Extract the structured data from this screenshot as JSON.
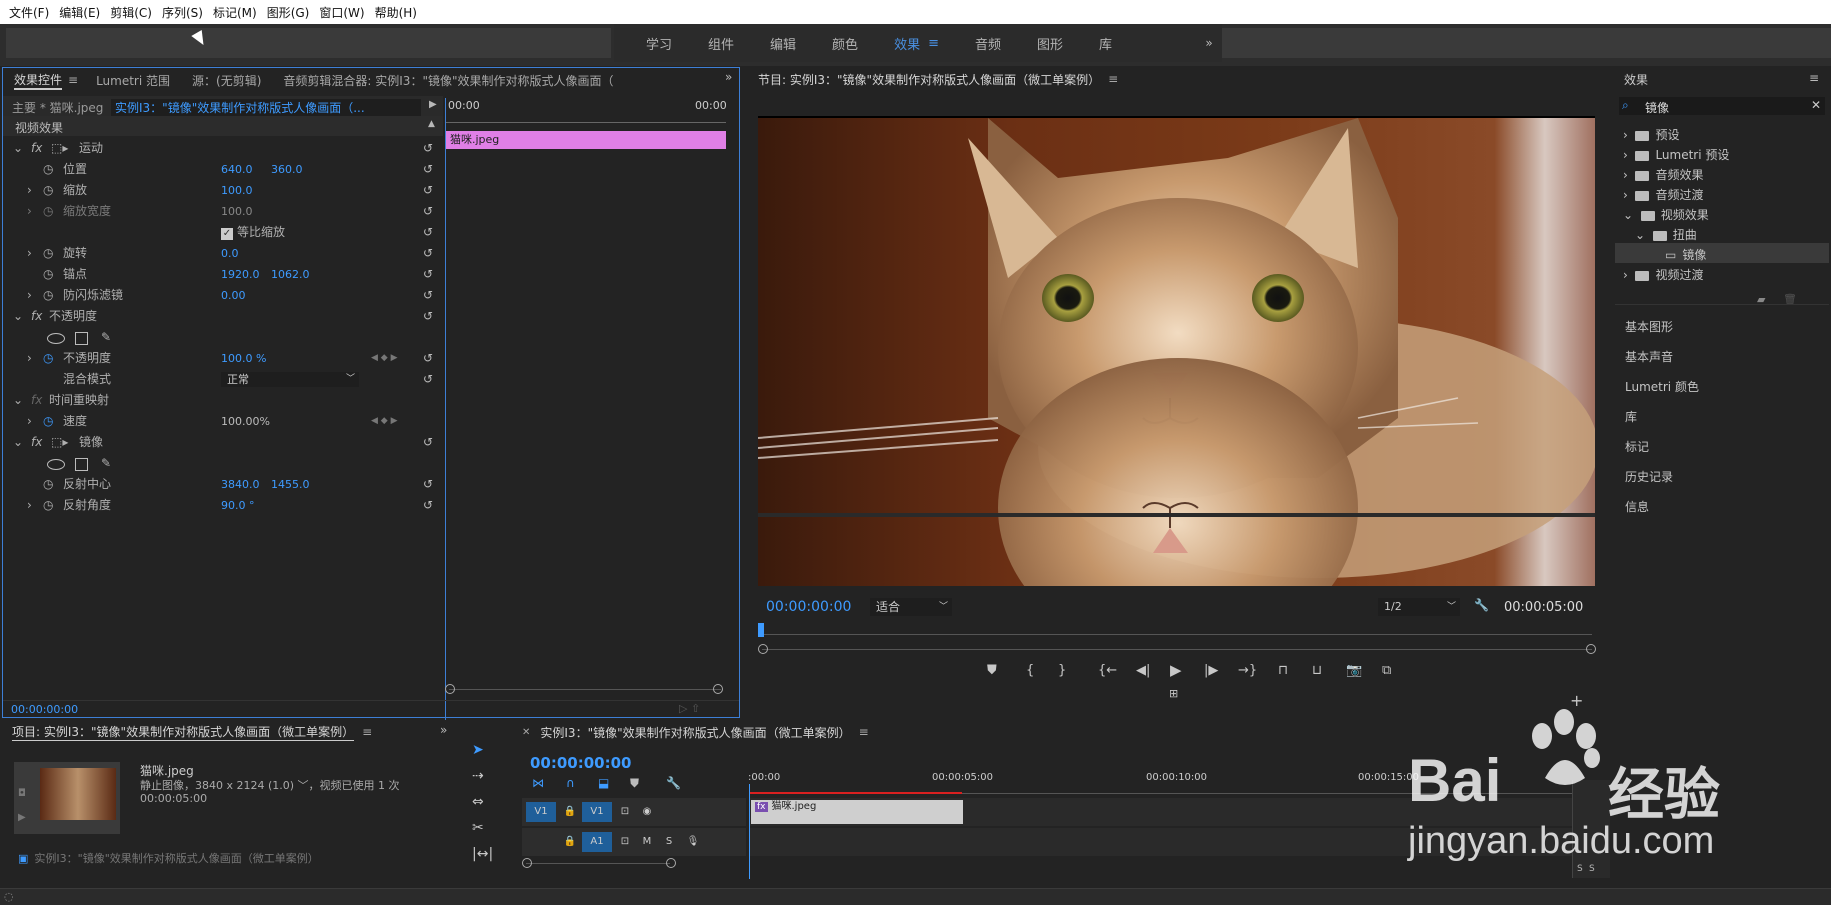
{
  "menu": [
    "文件(F)",
    "编辑(E)",
    "剪辑(C)",
    "序列(S)",
    "标记(M)",
    "图形(G)",
    "窗口(W)",
    "帮助(H)"
  ],
  "workspaces": [
    "学习",
    "组件",
    "编辑",
    "颜色",
    "效果",
    "音频",
    "图形",
    "库"
  ],
  "workspace_active": "效果",
  "ec": {
    "tabs": [
      "效果控件",
      "Lumetri 范围",
      "源：(无剪辑)",
      "音频剪辑混合器: 实例I3：\"镜像\"效果制作对称版式人像画面（"
    ],
    "master": "主要 * 猫咪.jpeg",
    "sequence": "实例I3：\"镜像\"效果制作对称版式人像画面（...",
    "tc_start": "00:00",
    "tc_end": "00:00",
    "clip_name": "猫咪.jpeg",
    "video_effects": "视频效果",
    "motion": "运动",
    "position": "位置",
    "pos_x": "640.0",
    "pos_y": "360.0",
    "scale": "缩放",
    "scale_val": "100.0",
    "scale_width": "缩放宽度",
    "scale_width_val": "100.0",
    "uniform": "等比缩放",
    "rotation": "旋转",
    "rotation_val": "0.0",
    "anchor": "锚点",
    "anchor_x": "1920.0",
    "anchor_y": "1062.0",
    "antiflicker": "防闪烁滤镜",
    "antiflicker_val": "0.00",
    "opacity": "不透明度",
    "opacity_prop": "不透明度",
    "opacity_val": "100.0 %",
    "blend": "混合模式",
    "blend_val": "正常",
    "time_remap": "时间重映射",
    "speed": "速度",
    "speed_val": "100.00%",
    "mirror": "镜像",
    "reflect_center": "反射中心",
    "rc_x": "3840.0",
    "rc_y": "1455.0",
    "reflect_angle": "反射角度",
    "ra_val": "90.0 °",
    "timecode": "00:00:00:00"
  },
  "program": {
    "title": "节目: 实例I3：\"镜像\"效果制作对称版式人像画面（微工单案例）",
    "tc": "00:00:00:00",
    "fit": "适合",
    "res": "1/2",
    "duration": "00:00:05:00"
  },
  "effects": {
    "title": "效果",
    "search": "镜像",
    "tree": [
      {
        "label": "预设",
        "level": 0
      },
      {
        "label": "Lumetri 预设",
        "level": 0
      },
      {
        "label": "音频效果",
        "level": 0
      },
      {
        "label": "音频过渡",
        "level": 0
      },
      {
        "label": "视频效果",
        "level": 0
      },
      {
        "label": "扭曲",
        "level": 1
      },
      {
        "label": "镜像",
        "level": 2
      },
      {
        "label": "视频过渡",
        "level": 0
      }
    ],
    "panels": [
      "基本图形",
      "基本声音",
      "Lumetri 颜色",
      "库",
      "标记",
      "历史记录",
      "信息"
    ]
  },
  "project": {
    "title": "项目: 实例I3：\"镜像\"效果制作对称版式人像画面（微工单案例）",
    "name": "猫咪.jpeg",
    "info": "静止图像，3840 x 2124 (1.0) ﹀，视频已使用 1 次",
    "dur": "00:00:05:00",
    "seq": "实例I3：\"镜像\"效果制作对称版式人像画面（微工单案例）"
  },
  "timeline": {
    "title": "实例I3：\"镜像\"效果制作对称版式人像画面（微工单案例）",
    "tc": "00:00:00:00",
    "ruler": [
      ":00:00",
      "00:00:05:00",
      "00:00:10:00",
      "00:00:15:00"
    ],
    "v1": "V1",
    "a1": "A1",
    "m": "M",
    "s": "S",
    "clip": "猫咪.jpeg"
  },
  "watermark": {
    "brand": "Bai",
    "suffix": "经验",
    "url": "jingyan.baidu.com"
  }
}
